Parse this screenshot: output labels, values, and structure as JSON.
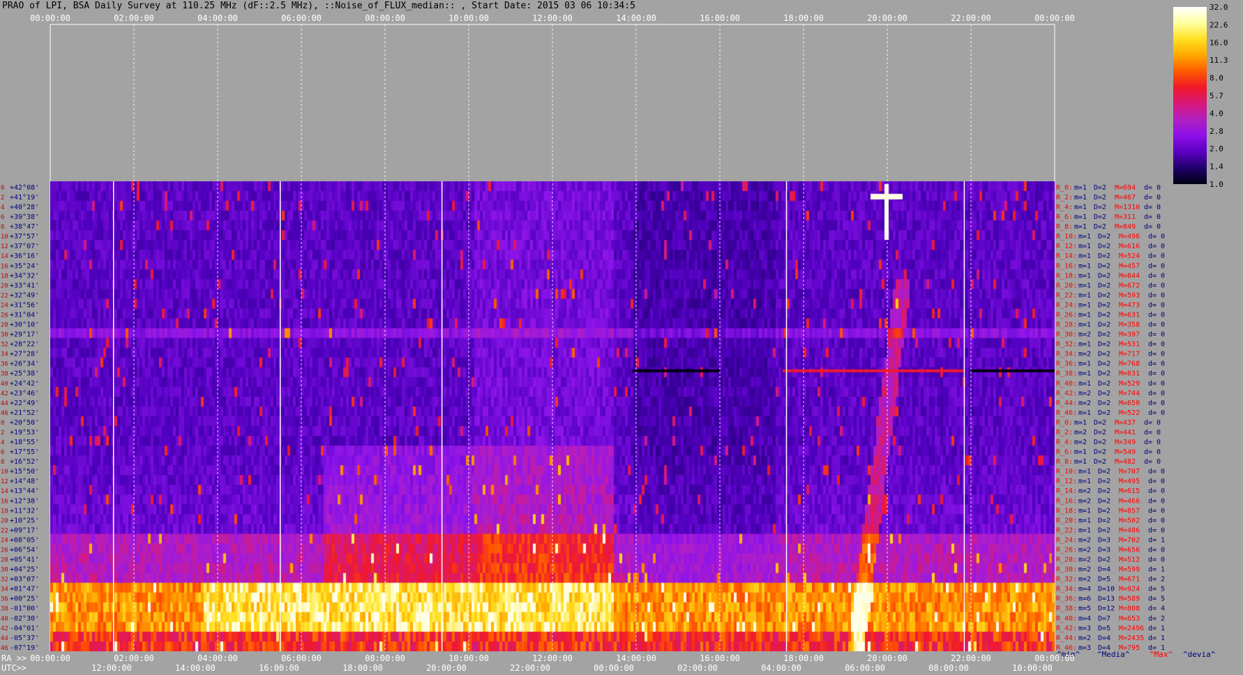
{
  "title": "PRAO of LPI, BSA Daily Survey at 110.25 MHz (dF::2.5 MHz), ::Noise_of_FLUX_median:: , Start Date: 2015 03 06 10:34:5",
  "chart_data": {
    "type": "heatmap",
    "title": "PRAO of LPI, BSA Daily Survey at 110.25 MHz (dF::2.5 MHz), ::Noise_of_FLUX_median:: , Start Date: 2015 03 06 10:34:5",
    "x_ticks_top": [
      "00:00:00",
      "02:00:00",
      "04:00:00",
      "06:00:00",
      "08:00:00",
      "10:00:00",
      "12:00:00",
      "14:00:00",
      "16:00:00",
      "18:00:00",
      "20:00:00",
      "22:00:00",
      "00:00:00"
    ],
    "x_ticks_ra": [
      "00:00:00",
      "02:00:00",
      "04:00:00",
      "06:00:00",
      "08:00:00",
      "10:00:00",
      "12:00:00",
      "14:00:00",
      "16:00:00",
      "18:00:00",
      "20:00:00",
      "22:00:00",
      "00:00:00"
    ],
    "x_ticks_utc": [
      "12:00:00",
      "14:00:00",
      "16:00:00",
      "18:00:00",
      "20:00:00",
      "22:00:00",
      "00:00:00",
      "02:00:00",
      "04:00:00",
      "06:00:00",
      "08:00:00",
      "10:00:00"
    ],
    "ra_axis_label": "RA >>",
    "utc_axis_label": "UTC>>",
    "colorbar": {
      "ticks": [
        "32.0",
        "22.6",
        "16.0",
        "11.3",
        "8.0",
        "5.7",
        "4.0",
        "2.8",
        "2.0",
        "1.4",
        "1.0"
      ],
      "colors": [
        "#000014",
        "#20006a",
        "#5a00c0",
        "#8c10e8",
        "#b020c0",
        "#d8187a",
        "#f01828",
        "#ff5a00",
        "#ffa800",
        "#ffe020",
        "#ffffa0",
        "#ffffff"
      ]
    },
    "rows": [
      {
        "idx": "0",
        "dec": "+42°08'"
      },
      {
        "idx": "2",
        "dec": "+41°19'"
      },
      {
        "idx": "4",
        "dec": "+40°28'"
      },
      {
        "idx": "6",
        "dec": "+39°38'"
      },
      {
        "idx": "8",
        "dec": "+38°47'"
      },
      {
        "idx": "10",
        "dec": "+37°57'"
      },
      {
        "idx": "12",
        "dec": "+37°07'"
      },
      {
        "idx": "14",
        "dec": "+36°16'"
      },
      {
        "idx": "16",
        "dec": "+35°24'"
      },
      {
        "idx": "18",
        "dec": "+34°32'"
      },
      {
        "idx": "20",
        "dec": "+33°41'"
      },
      {
        "idx": "22",
        "dec": "+32°49'"
      },
      {
        "idx": "24",
        "dec": "+31°56'"
      },
      {
        "idx": "26",
        "dec": "+31°04'"
      },
      {
        "idx": "28",
        "dec": "+30°10'"
      },
      {
        "idx": "30",
        "dec": "+29°17'"
      },
      {
        "idx": "32",
        "dec": "+28°22'"
      },
      {
        "idx": "34",
        "dec": "+27°28'"
      },
      {
        "idx": "36",
        "dec": "+26°34'"
      },
      {
        "idx": "38",
        "dec": "+25°38'"
      },
      {
        "idx": "40",
        "dec": "+24°42'"
      },
      {
        "idx": "42",
        "dec": "+23°46'"
      },
      {
        "idx": "44",
        "dec": "+22°49'"
      },
      {
        "idx": "46",
        "dec": "+21°52'"
      },
      {
        "idx": "0",
        "dec": "+20°50'"
      },
      {
        "idx": "2",
        "dec": "+19°53'"
      },
      {
        "idx": "4",
        "dec": "+18°55'"
      },
      {
        "idx": "6",
        "dec": "+17°55'"
      },
      {
        "idx": "8",
        "dec": "+16°52'"
      },
      {
        "idx": "10",
        "dec": "+15°50'"
      },
      {
        "idx": "12",
        "dec": "+14°48'"
      },
      {
        "idx": "14",
        "dec": "+13°44'"
      },
      {
        "idx": "16",
        "dec": "+12°38'"
      },
      {
        "idx": "18",
        "dec": "+11°32'"
      },
      {
        "idx": "20",
        "dec": "+10°25'"
      },
      {
        "idx": "22",
        "dec": "+09°17'"
      },
      {
        "idx": "24",
        "dec": "+08°05'"
      },
      {
        "idx": "26",
        "dec": "+06°54'"
      },
      {
        "idx": "28",
        "dec": "+05°41'"
      },
      {
        "idx": "30",
        "dec": "+04°25'"
      },
      {
        "idx": "32",
        "dec": "+03°07'"
      },
      {
        "idx": "34",
        "dec": "+01°47'"
      },
      {
        "idx": "36",
        "dec": "+00°25'"
      },
      {
        "idx": "38",
        "dec": "-01°00'"
      },
      {
        "idx": "40",
        "dec": "-02°30'"
      },
      {
        "idx": "42",
        "dec": "-04°01'"
      },
      {
        "idx": "44",
        "dec": "-05°37'"
      },
      {
        "idx": "46",
        "dec": "-07°19'"
      }
    ],
    "row_stats": [
      {
        "r": "R_0:",
        "m": "m=1",
        "d": "D=2",
        "M": "M=694",
        "dev": "d= 0"
      },
      {
        "r": "R_2:",
        "m": "m=1",
        "d": "D=2",
        "M": "M=467",
        "dev": "d= 0"
      },
      {
        "r": "R_4:",
        "m": "m=1",
        "d": "D=2",
        "M": "M=1310",
        "dev": "d= 0"
      },
      {
        "r": "R_6:",
        "m": "m=1",
        "d": "D=2",
        "M": "M=311",
        "dev": "d= 0"
      },
      {
        "r": "R_8:",
        "m": "m=1",
        "d": "D=2",
        "M": "M=849",
        "dev": "d= 0"
      },
      {
        "r": "R_10:",
        "m": "m=1",
        "d": "D=2",
        "M": "M=496",
        "dev": "d= 0"
      },
      {
        "r": "R_12:",
        "m": "m=1",
        "d": "D=2",
        "M": "M=616",
        "dev": "d= 0"
      },
      {
        "r": "R_14:",
        "m": "m=1",
        "d": "D=2",
        "M": "M=524",
        "dev": "d= 0"
      },
      {
        "r": "R_16:",
        "m": "m=1",
        "d": "D=2",
        "M": "M=457",
        "dev": "d= 0"
      },
      {
        "r": "R_18:",
        "m": "m=1",
        "d": "D=2",
        "M": "M=844",
        "dev": "d= 0"
      },
      {
        "r": "R_20:",
        "m": "m=1",
        "d": "D=2",
        "M": "M=672",
        "dev": "d= 0"
      },
      {
        "r": "R_22:",
        "m": "m=1",
        "d": "D=2",
        "M": "M=593",
        "dev": "d= 0"
      },
      {
        "r": "R_24:",
        "m": "m=1",
        "d": "D=2",
        "M": "M=473",
        "dev": "d= 0"
      },
      {
        "r": "R_26:",
        "m": "m=1",
        "d": "D=2",
        "M": "M=631",
        "dev": "d= 0"
      },
      {
        "r": "R_28:",
        "m": "m=1",
        "d": "D=2",
        "M": "M=358",
        "dev": "d= 0"
      },
      {
        "r": "R_30:",
        "m": "m=2",
        "d": "D=2",
        "M": "M=397",
        "dev": "d= 0"
      },
      {
        "r": "R_32:",
        "m": "m=1",
        "d": "D=2",
        "M": "M=531",
        "dev": "d= 0"
      },
      {
        "r": "R_34:",
        "m": "m=2",
        "d": "D=2",
        "M": "M=717",
        "dev": "d= 0"
      },
      {
        "r": "R_36:",
        "m": "m=1",
        "d": "D=2",
        "M": "M=768",
        "dev": "d= 0"
      },
      {
        "r": "R_38:",
        "m": "m=1",
        "d": "D=2",
        "M": "M=831",
        "dev": "d= 0"
      },
      {
        "r": "R_40:",
        "m": "m=1",
        "d": "D=2",
        "M": "M=529",
        "dev": "d= 0"
      },
      {
        "r": "R_42:",
        "m": "m=2",
        "d": "D=2",
        "M": "M=744",
        "dev": "d= 0"
      },
      {
        "r": "R_44:",
        "m": "m=2",
        "d": "D=2",
        "M": "M=650",
        "dev": "d= 0"
      },
      {
        "r": "R_46:",
        "m": "m=1",
        "d": "D=2",
        "M": "M=522",
        "dev": "d= 0"
      },
      {
        "r": "R_0:",
        "m": "m=1",
        "d": "D=2",
        "M": "M=437",
        "dev": "d= 0"
      },
      {
        "r": "R_2:",
        "m": "m=2",
        "d": "D=2",
        "M": "M=441",
        "dev": "d= 0"
      },
      {
        "r": "R_4:",
        "m": "m=2",
        "d": "D=2",
        "M": "M=349",
        "dev": "d= 0"
      },
      {
        "r": "R_6:",
        "m": "m=1",
        "d": "D=2",
        "M": "M=549",
        "dev": "d= 0"
      },
      {
        "r": "R_8:",
        "m": "m=1",
        "d": "D=2",
        "M": "M=482",
        "dev": "d= 0"
      },
      {
        "r": "R_10:",
        "m": "m=1",
        "d": "D=2",
        "M": "M=707",
        "dev": "d= 0"
      },
      {
        "r": "R_12:",
        "m": "m=1",
        "d": "D=2",
        "M": "M=495",
        "dev": "d= 0"
      },
      {
        "r": "R_14:",
        "m": "m=2",
        "d": "D=2",
        "M": "M=615",
        "dev": "d= 0"
      },
      {
        "r": "R_16:",
        "m": "m=2",
        "d": "D=2",
        "M": "M=466",
        "dev": "d= 0"
      },
      {
        "r": "R_18:",
        "m": "m=1",
        "d": "D=2",
        "M": "M=857",
        "dev": "d= 0"
      },
      {
        "r": "R_20:",
        "m": "m=1",
        "d": "D=2",
        "M": "M=502",
        "dev": "d= 0"
      },
      {
        "r": "R_22:",
        "m": "m=1",
        "d": "D=2",
        "M": "M=486",
        "dev": "d= 0"
      },
      {
        "r": "R_24:",
        "m": "m=2",
        "d": "D=3",
        "M": "M=702",
        "dev": "d= 1"
      },
      {
        "r": "R_26:",
        "m": "m=2",
        "d": "D=3",
        "M": "M=656",
        "dev": "d= 0"
      },
      {
        "r": "R_28:",
        "m": "m=2",
        "d": "D=2",
        "M": "M=512",
        "dev": "d= 0"
      },
      {
        "r": "R_30:",
        "m": "m=2",
        "d": "D=4",
        "M": "M=599",
        "dev": "d= 1"
      },
      {
        "r": "R_32:",
        "m": "m=2",
        "d": "D=5",
        "M": "M=671",
        "dev": "d= 2"
      },
      {
        "r": "R_34:",
        "m": "m=4",
        "d": "D=10",
        "M": "M=924",
        "dev": "d= 5"
      },
      {
        "r": "R_36:",
        "m": "m=6",
        "d": "D=13",
        "M": "M=589",
        "dev": "d= 5"
      },
      {
        "r": "R_38:",
        "m": "m=5",
        "d": "D=12",
        "M": "M=808",
        "dev": "d= 4"
      },
      {
        "r": "R_40:",
        "m": "m=4",
        "d": "D=7",
        "M": "M=653",
        "dev": "d= 2"
      },
      {
        "r": "R_42:",
        "m": "m=3",
        "d": "D=5",
        "M": "M=2496",
        "dev": "d= 1"
      },
      {
        "r": "R_44:",
        "m": "m=2",
        "d": "D=4",
        "M": "M=2435",
        "dev": "d= 1"
      },
      {
        "r": "R_46:",
        "m": "m=3",
        "d": "D=4",
        "M": "M=795",
        "dev": "d= 1"
      }
    ],
    "legend": {
      "min": "^min^",
      "media": "^Media^",
      "max": "^Max^",
      "devia": "^devia^"
    },
    "colors": {
      "row_label": "#cc0000",
      "dec_label": "#000080",
      "stat_m": "#000080",
      "stat_max": "#ff0000",
      "grid": "#ffffff"
    }
  }
}
